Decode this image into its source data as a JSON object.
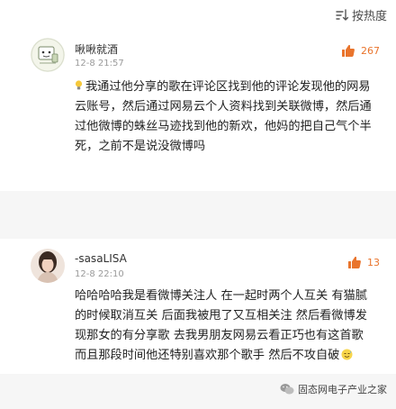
{
  "toolbar": {
    "sort_label": "按热度",
    "sort_icon": "sort-icon"
  },
  "comments": [
    {
      "username": "啾啾就酒",
      "timestamp": "12-8 21:57",
      "likes": "267",
      "prefix_icon": "lightbulb-icon",
      "text": "我通过他分享的歌在评论区找到他的评论发现他的网易云账号，然后通过网易云个人资料找到关联微博，然后通过他微博的蛛丝马迹找到他的新欢，他妈的把自己气个半死，之前不是说没微博吗"
    },
    {
      "username": "-sasaLISA",
      "timestamp": "12-8 22:10",
      "likes": "13",
      "suffix_icon": "sweat-smile-emoji",
      "text": "哈哈哈哈我是看微博关注人 在一起时两个人互关 有猫腻的时候取消互关 后面我被甩了又互相关注 然后看微博发现那女的有分享歌 去我男朋友网易云看正巧也有这首歌 而且那段时间他还特别喜欢那个歌手 然后不攻自破"
    }
  ],
  "watermark": {
    "text": "固态网电子产业之家",
    "icon": "wechat-icon"
  },
  "colors": {
    "accent": "#e9742c",
    "background": "#f6f6f6",
    "card": "#ffffff"
  }
}
